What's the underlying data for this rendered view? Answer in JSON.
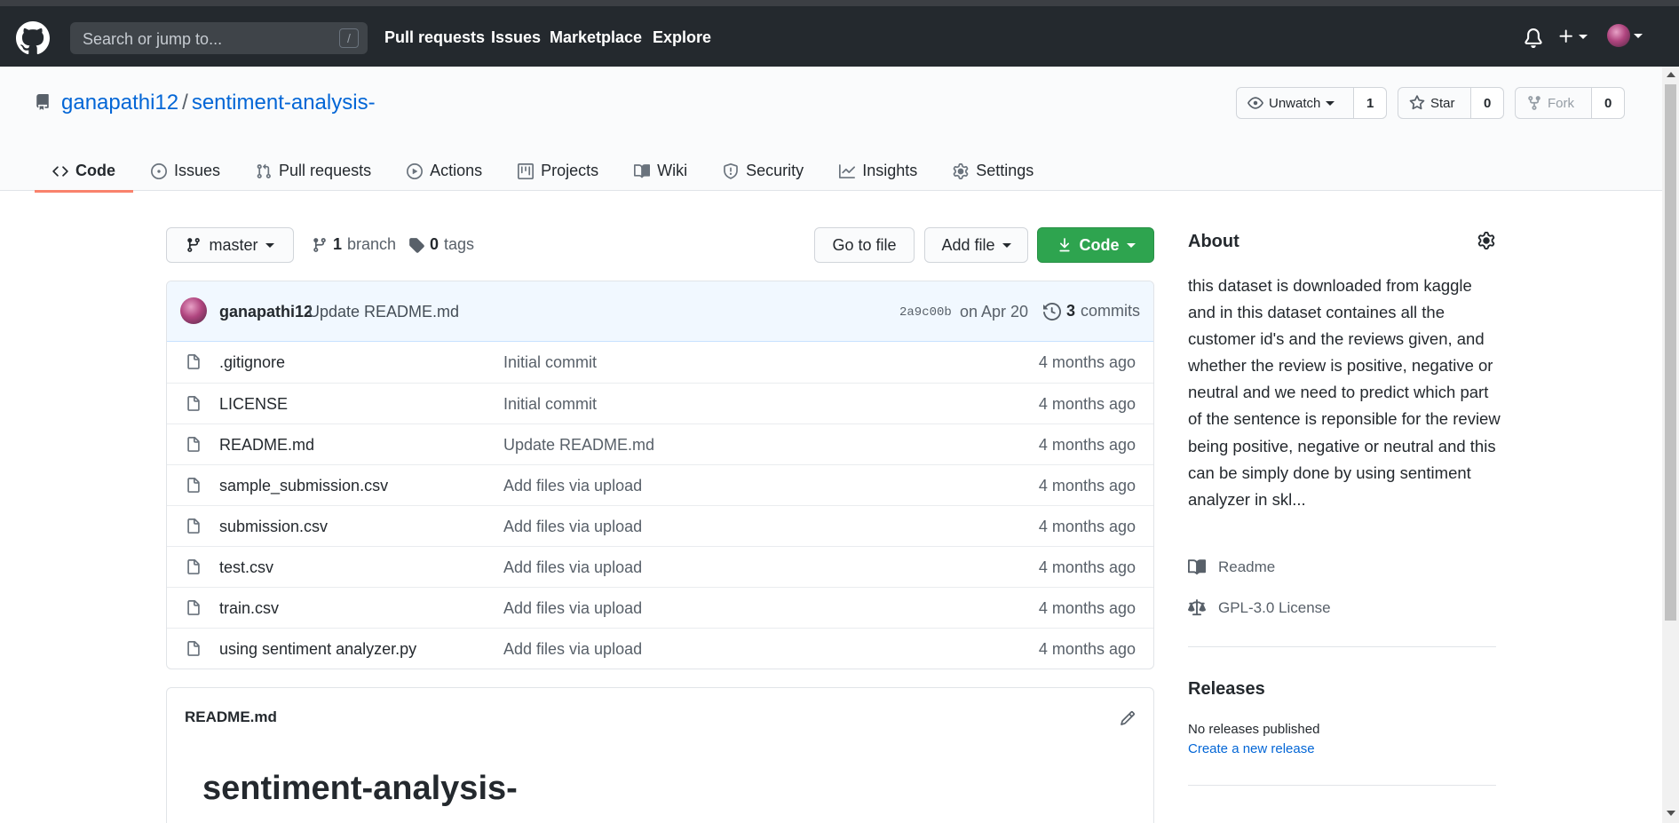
{
  "header": {
    "search_placeholder": "Search or jump to...",
    "search_shortcut": "/",
    "nav": [
      "Pull requests",
      "Issues",
      "Marketplace",
      "Explore"
    ]
  },
  "repo": {
    "owner": "ganapathi12",
    "separator": "/",
    "name": "sentiment-analysis-",
    "unwatch_label": "Unwatch",
    "watch_count": "1",
    "star_label": "Star",
    "star_count": "0",
    "fork_label": "Fork",
    "fork_count": "0"
  },
  "tabs": [
    {
      "label": "Code",
      "icon": "code-icon"
    },
    {
      "label": "Issues",
      "icon": "issue-icon"
    },
    {
      "label": "Pull requests",
      "icon": "pull-request-icon"
    },
    {
      "label": "Actions",
      "icon": "play-icon"
    },
    {
      "label": "Projects",
      "icon": "project-icon"
    },
    {
      "label": "Wiki",
      "icon": "book-icon"
    },
    {
      "label": "Security",
      "icon": "shield-icon"
    },
    {
      "label": "Insights",
      "icon": "graph-icon"
    },
    {
      "label": "Settings",
      "icon": "gear-icon"
    }
  ],
  "selected_tab": "Code",
  "toolbar": {
    "branch": "master",
    "branch_count": "1",
    "branch_word": "branch",
    "tag_count": "0",
    "tag_word": "tags",
    "goto_file": "Go to file",
    "add_file": "Add file",
    "code": "Code"
  },
  "commit": {
    "author": "ganapathi12",
    "message": "Update README.md",
    "sha": "2a9c00b",
    "date": "on Apr 20",
    "count": "3",
    "count_word": "commits"
  },
  "files": [
    {
      "name": ".gitignore",
      "message": "Initial commit",
      "age": "4 months ago"
    },
    {
      "name": "LICENSE",
      "message": "Initial commit",
      "age": "4 months ago"
    },
    {
      "name": "README.md",
      "message": "Update README.md",
      "age": "4 months ago"
    },
    {
      "name": "sample_submission.csv",
      "message": "Add files via upload",
      "age": "4 months ago"
    },
    {
      "name": "submission.csv",
      "message": "Add files via upload",
      "age": "4 months ago"
    },
    {
      "name": "test.csv",
      "message": "Add files via upload",
      "age": "4 months ago"
    },
    {
      "name": "train.csv",
      "message": "Add files via upload",
      "age": "4 months ago"
    },
    {
      "name": "using sentiment analyzer.py",
      "message": "Add files via upload",
      "age": "4 months ago"
    }
  ],
  "readme": {
    "filename": "README.md",
    "heading": "sentiment-analysis-"
  },
  "about": {
    "title": "About",
    "description": "this dataset is downloaded from kaggle and in this dataset containes all the customer id's and the reviews given, and whether the review is positive, negative or neutral and we need to predict which part of the sentence is reponsible for the review being positive, negative or neutral and this can be simply done by using sentiment analyzer in skl...",
    "readme_link": "Readme",
    "license_link": "GPL-3.0 License"
  },
  "releases": {
    "title": "Releases",
    "none_text": "No releases published",
    "create_link": "Create a new release"
  },
  "colors": {
    "header_bg": "#24292e",
    "link_blue": "#0366d6",
    "green_button": "#2ea44f",
    "tab_underline": "#f9826c"
  }
}
